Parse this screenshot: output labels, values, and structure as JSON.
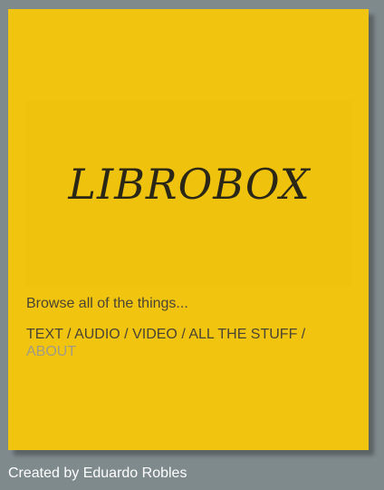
{
  "logo": {
    "text": "LIBROBOX"
  },
  "tagline": "Browse all of the things...",
  "nav": {
    "items": [
      {
        "label": "TEXT"
      },
      {
        "label": "AUDIO"
      },
      {
        "label": "VIDEO"
      },
      {
        "label": "ALL THE STUFF"
      },
      {
        "label": "ABOUT",
        "active": true
      }
    ],
    "separator": " / "
  },
  "footer": {
    "credit": "Created by Eduardo Robles"
  },
  "colors": {
    "background": "#7f8a8d",
    "card": "#f1c40f",
    "text": "#4a4434",
    "active_link": "#a19b86",
    "footer_text": "#ffffff"
  }
}
